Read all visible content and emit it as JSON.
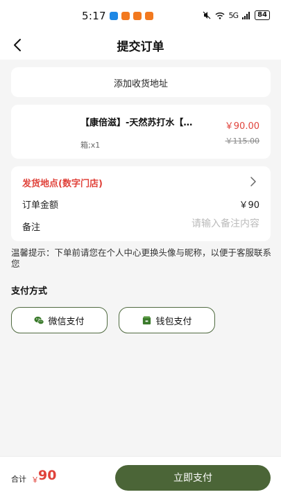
{
  "status_bar": {
    "time": "5:17",
    "network": "5G",
    "battery": "84",
    "app_colors": [
      "#1e88e5",
      "#f2791f",
      "#f2791f",
      "#f2791f"
    ]
  },
  "nav": {
    "title": "提交订单",
    "back_icon": "chevron-left-icon"
  },
  "address": {
    "label": "添加收货地址"
  },
  "product": {
    "name": "【康倍滋】-天然苏打水【…",
    "spec": "箱;x1",
    "price": "￥90.00",
    "original_price": "￥115.00"
  },
  "order_info": {
    "ship_label": "发货地点(数字门店)",
    "amount_label": "订单金额",
    "amount_value": "￥90",
    "remark_label": "备注",
    "remark_placeholder": "请输入备注内容",
    "remark_value": ""
  },
  "tip": "温馨提示：下单前请您在个人中心更换头像与昵称，以便于客服联系您",
  "payment": {
    "title": "支付方式",
    "wechat_label": "微信支付",
    "wallet_label": "钱包支付"
  },
  "footer": {
    "total_label": "合计",
    "currency": "￥",
    "total_value": "90",
    "submit_label": "立即支付"
  },
  "colors": {
    "accent_green": "#4b6537",
    "price_red": "#e0433b",
    "background": "#f5f5f5"
  }
}
